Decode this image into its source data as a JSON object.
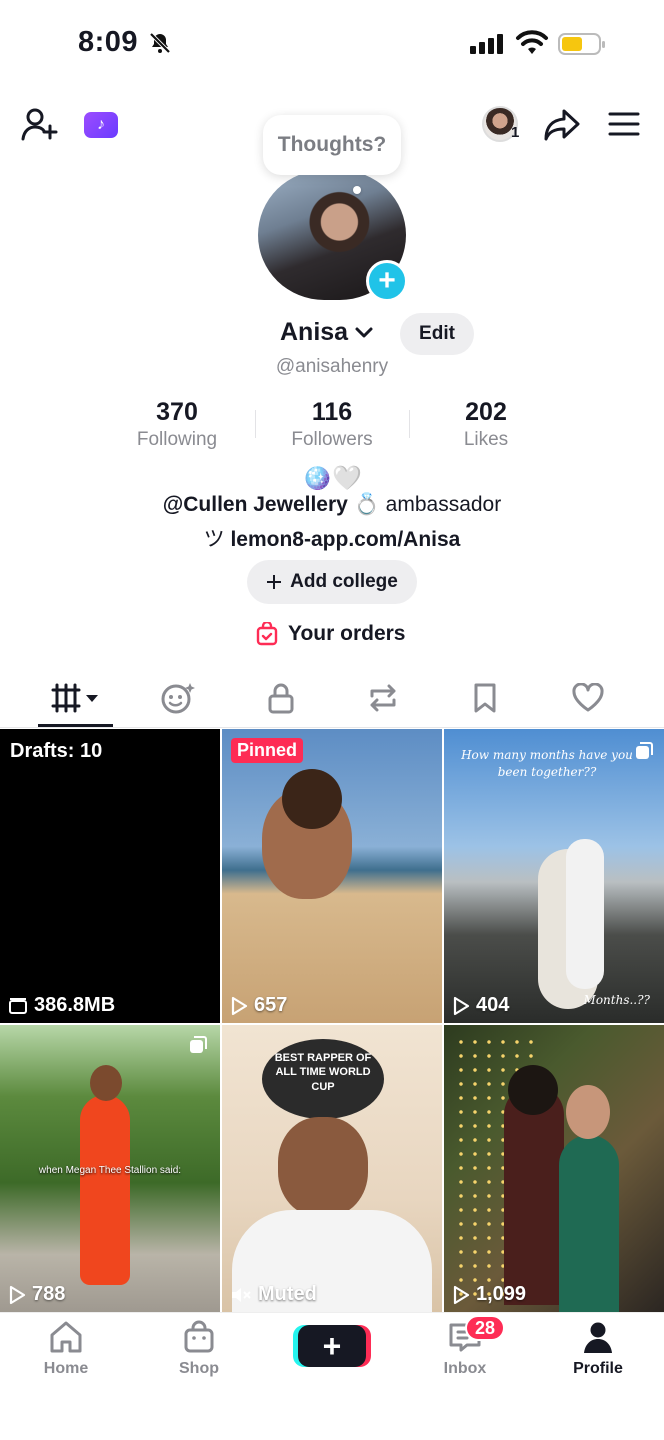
{
  "status_bar": {
    "time": "8:09"
  },
  "header": {
    "story_count": "1"
  },
  "profile": {
    "tooltip": "Thoughts?",
    "name": "Anisa",
    "edit_label": "Edit",
    "handle": "@anisahenry",
    "stats": [
      {
        "value": "370",
        "label": "Following"
      },
      {
        "value": "116",
        "label": "Followers"
      },
      {
        "value": "202",
        "label": "Likes"
      }
    ],
    "bio_line1": "🪩🤍",
    "bio_line2_brand": "@Cullen Jewellery",
    "bio_line2_ring": "💍",
    "bio_line2_rest": "ambassador",
    "link_icon": "ツ",
    "link": "lemon8-app.com/Anisa",
    "add_college_label": "Add college",
    "orders_label": "Your orders"
  },
  "tabs": [
    {
      "name": "videos-grid-icon"
    },
    {
      "name": "reposts-face-icon"
    },
    {
      "name": "private-lock-icon"
    },
    {
      "name": "repost-icon"
    },
    {
      "name": "bookmark-icon"
    },
    {
      "name": "heart-icon"
    }
  ],
  "grid": [
    {
      "badge": "Drafts: 10",
      "footer": "386.8MB"
    },
    {
      "badge": "Pinned",
      "footer": "657"
    },
    {
      "caption": "How many months have you been together??",
      "caption2": "Months..??",
      "footer": "404"
    },
    {
      "caption": "when Megan Thee Stallion said:",
      "footer": "788"
    },
    {
      "caption": "BEST RAPPER OF ALL TIME WORLD CUP",
      "footer": "Muted"
    },
    {
      "footer": "1,099"
    }
  ],
  "nav": {
    "home": "Home",
    "shop": "Shop",
    "create": "+",
    "inbox": "Inbox",
    "inbox_badge": "28",
    "profile": "Profile"
  },
  "colors": {
    "accent": "#fe2c55",
    "cyan": "#25f4ee",
    "plus_blue": "#20c3e8"
  }
}
